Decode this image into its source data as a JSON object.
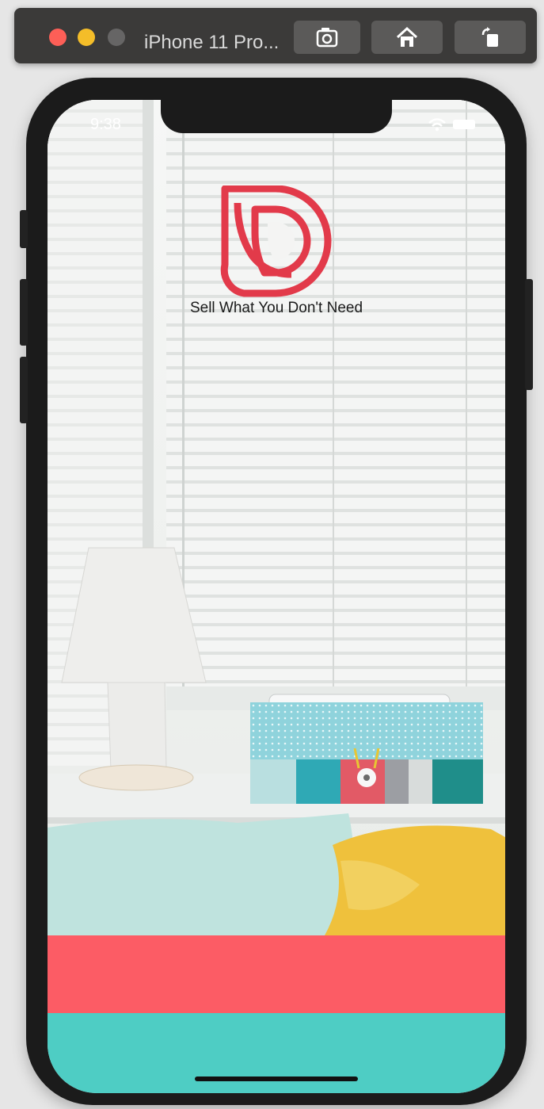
{
  "simulator": {
    "title": "iPhone 11 Pro...",
    "buttons": [
      "screenshot-icon",
      "home-icon",
      "rotate-icon"
    ]
  },
  "status_bar": {
    "time": "9:38"
  },
  "app": {
    "logo_name": "D logo",
    "tagline": "Sell What You Don't Need"
  },
  "colors": {
    "logo_red": "#e23a4a",
    "button_coral": "#fc5c65",
    "button_teal": "#4ecdc4",
    "device_frame": "#1b1b1b"
  }
}
